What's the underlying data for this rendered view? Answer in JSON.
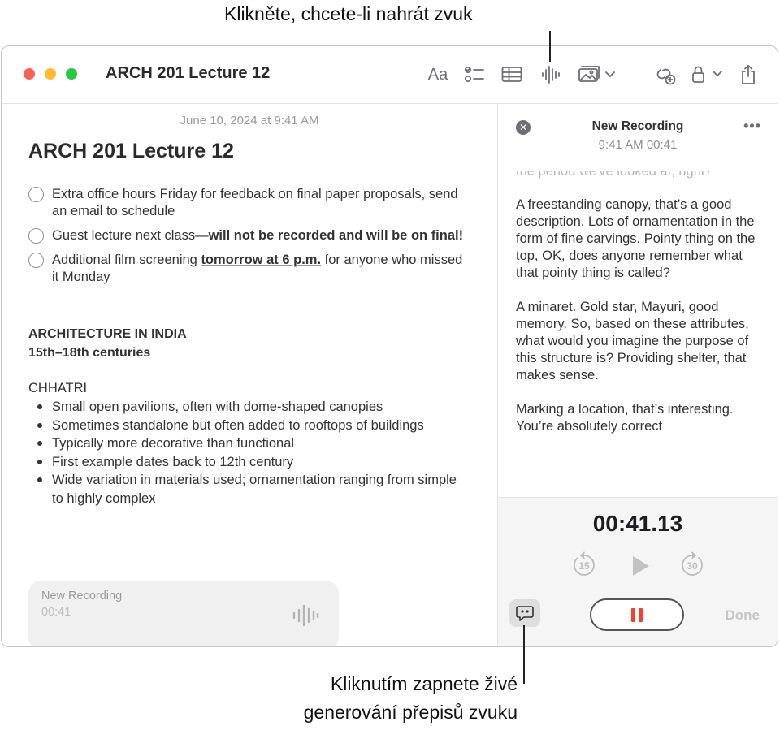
{
  "callouts": {
    "top": "Klikněte, chcete-li nahrát zvuk",
    "bottom_line1": "Kliknutím zapnete živé",
    "bottom_line2": "generování přepisů zvuku"
  },
  "window": {
    "title": "ARCH 201 Lecture 12",
    "toolbar": {
      "format_label": "Aa",
      "icons": [
        "format-icon",
        "checklist-icon",
        "table-icon",
        "audio-waveform-icon",
        "media-icon",
        "collaborate-icon",
        "lock-icon",
        "share-icon"
      ]
    }
  },
  "note": {
    "date": "June 10, 2024 at 9:41 AM",
    "title": "ARCH 201 Lecture 12",
    "checklist": [
      {
        "text": "Extra office hours Friday for feedback on final paper proposals, send an email to schedule"
      },
      {
        "text_plain": "Guest lecture next class—",
        "text_bold": "will not be recorded and will be on final!"
      },
      {
        "pre": "Additional film screening ",
        "emph": "tomorrow at 6 p.m.",
        "post": " for anyone who missed it Monday"
      }
    ],
    "section_heading": "ARCHITECTURE IN INDIA",
    "section_subheading": "15th–18th centuries",
    "list_heading": "CHHATRI",
    "bullets": [
      "Small open pavilions, often with dome-shaped canopies",
      "Sometimes standalone but often added to rooftops of buildings",
      "Typically more decorative than functional",
      "First example dates back to 12th century",
      "Wide variation in materials used; ornamentation ranging from simple to highly complex"
    ],
    "recording_card": {
      "name": "New Recording",
      "duration": "00:41"
    }
  },
  "panel": {
    "title": "New Recording",
    "subtitle": "9:41 AM  00:41",
    "more": "•••",
    "transcript_faded": "the period we've looked at, right?",
    "transcript": [
      "A freestanding canopy, that’s a good description. Lots of ornamentation in the form of fine carvings. Pointy thing on the top, OK, does anyone remember what that pointy thing is called?",
      "A minaret. Gold star, Mayuri, good memory. So, based on these attributes, what would you imagine the purpose of this structure is? Providing shelter, that makes sense.",
      "Marking a location, that’s interesting. You’re absolutely correct"
    ],
    "timer": "00:41.13",
    "skip_back": "15",
    "skip_forward": "30",
    "done_label": "Done",
    "colors": {
      "record_red": "#ff3b30"
    }
  }
}
